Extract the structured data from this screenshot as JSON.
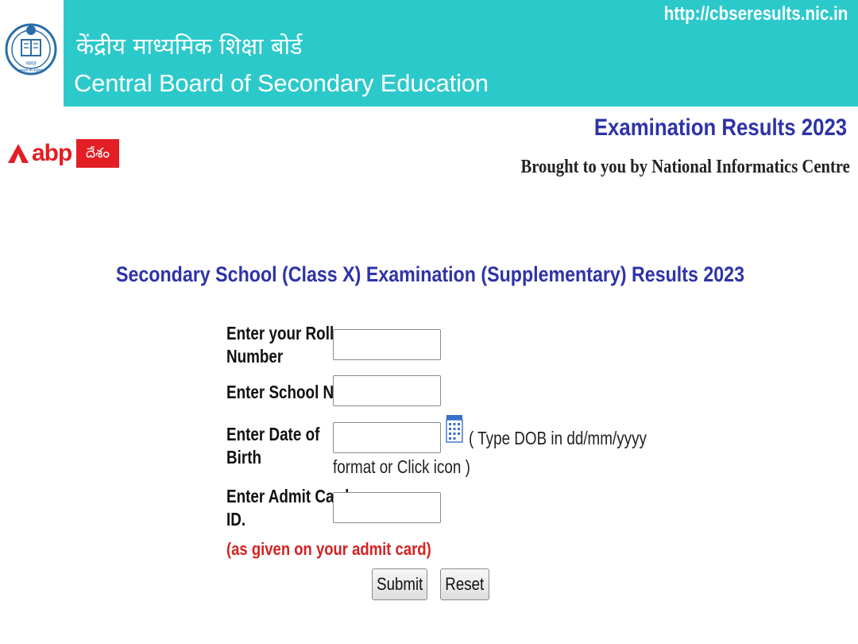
{
  "header": {
    "title_hindi": "केंद्रीय माध्यमिक शिक्षा बोर्ड",
    "title_english": "Central Board of Secondary Education",
    "url": "http://cbseresults.nic.in",
    "logo_text": "भारत",
    "logo_motto": "असतो मा सद्गमय",
    "bg_color": "#2cc9cb"
  },
  "watermark": {
    "brand": "abp",
    "badge": "దేశం",
    "color": "#e31e24"
  },
  "banner": {
    "exam_results": "Examination Results 2023",
    "brought_by": "Brought to you by National Informatics Centre"
  },
  "form": {
    "heading": "Secondary School (Class X) Examination (Supplementary) Results 2023",
    "roll_label_line1": "Enter your Roll",
    "roll_label_line2": "Number",
    "roll_value": "",
    "school_label": "Enter School No.",
    "school_value": "",
    "dob_label_line1": "Enter Date of",
    "dob_label_line2": "Birth",
    "dob_value": "",
    "dob_hint_line1": "( Type DOB in dd/mm/yyyy",
    "dob_hint_line2": "format or Click icon )",
    "admit_label_line1": "Enter Admit Card",
    "admit_label_line2": "ID.",
    "admit_value": "",
    "admit_note": "(as given on your admit card)",
    "submit_label": "Submit",
    "reset_label": "Reset"
  }
}
